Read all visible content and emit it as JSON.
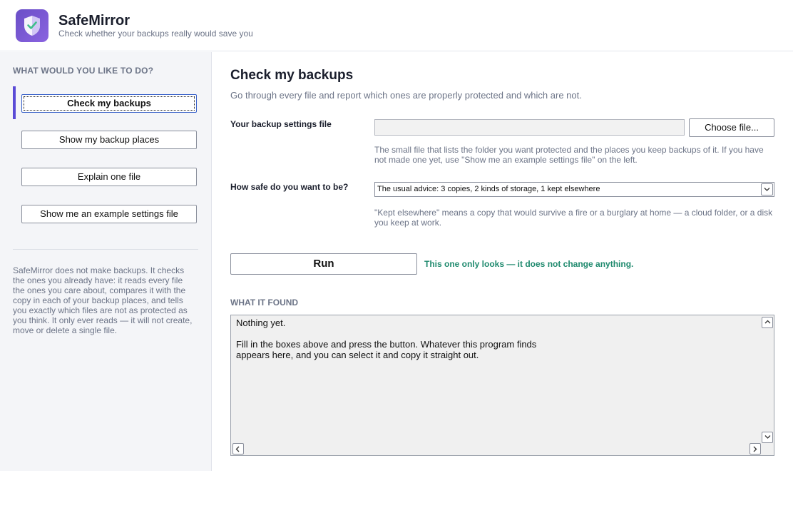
{
  "app": {
    "title": "SafeMirror",
    "subtitle": "Check whether your backups really would save you",
    "logo_icon": "shield-check-icon",
    "accent": "#5a4bd6"
  },
  "sidebar": {
    "heading": "WHAT WOULD YOU LIKE TO DO?",
    "items": [
      {
        "label": "Check my backups",
        "active": true
      },
      {
        "label": "Show my backup places",
        "active": false
      },
      {
        "label": "Explain one file",
        "active": false
      },
      {
        "label": "Show me an example settings file",
        "active": false
      }
    ],
    "description": "SafeMirror does not make backups. It checks the ones you already have: it reads every file the ones you care about, compares it with the copy in each of your backup places, and tells you exactly which files are not as protected as you think. It only ever reads — it will not create, move or delete a single file."
  },
  "main": {
    "title": "Check my backups",
    "subtitle": "Go through every file and report which ones are properly protected and which are not.",
    "settings_file": {
      "label": "Your backup settings file",
      "value": "",
      "choose_label": "Choose file...",
      "hint": "The small file that lists the folder you want protected and the places you keep backups of it. If you have not made one yet, use \"Show me an example settings file\" on the left."
    },
    "safety": {
      "label": "How safe do you want to be?",
      "selected": "The usual advice: 3 copies, 2 kinds of storage, 1 kept elsewhere",
      "hint": "\"Kept elsewhere\" means a copy that would survive a fire or a burglary at home — a cloud folder, or a disk you keep at work."
    },
    "run_label": "Run",
    "run_note": "This one only looks — it does not change anything.",
    "run_note_color": "#1f8a6e",
    "found_heading": "WHAT IT FOUND",
    "output": "Nothing yet.\n\nFill in the boxes above and press the button. Whatever this program finds\nappears here, and you can select it and copy it straight out."
  }
}
